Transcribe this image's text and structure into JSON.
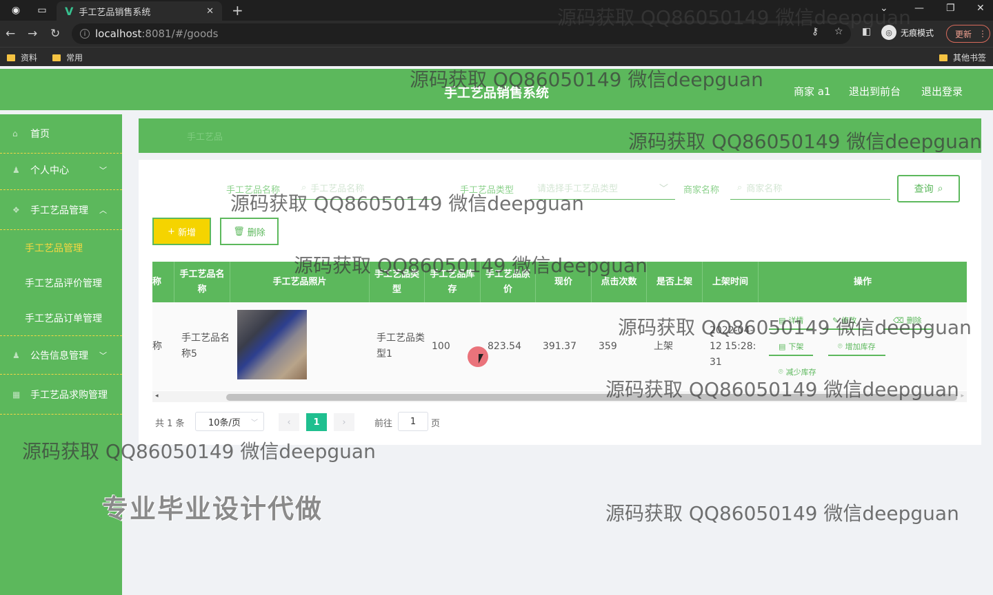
{
  "browser": {
    "tab_title": "手工艺品销售系统",
    "url_host": "localhost",
    "url_path": ":8081/#/goods",
    "incognito_label": "无痕模式",
    "update_label": "更新",
    "bookmarks": [
      "资料",
      "常用"
    ],
    "other_bookmarks": "其他书签"
  },
  "header": {
    "title": "手工艺品销售系统",
    "user": "商家 a1",
    "back_front": "退出到前台",
    "logout": "退出登录"
  },
  "sidebar": {
    "items": [
      {
        "label": "首页"
      },
      {
        "label": "个人中心"
      },
      {
        "label": "手工艺品管理"
      },
      {
        "label": "公告信息管理"
      },
      {
        "label": "手工艺品求购管理"
      }
    ],
    "sub_items": [
      "手工艺品管理",
      "手工艺品评价管理",
      "手工艺品订单管理"
    ]
  },
  "breadcrumb": "手工艺品",
  "filters": {
    "name_label": "手工艺品名称",
    "name_placeholder": "手工艺品名称",
    "type_label": "手工艺品类型",
    "type_placeholder": "请选择手工艺品类型",
    "shop_label": "商家名称",
    "shop_placeholder": "商家名称",
    "search_button": "查询"
  },
  "buttons": {
    "add": "新增",
    "delete": "删除"
  },
  "table": {
    "headers": [
      "称",
      "手工艺品名称",
      "手工艺品照片",
      "手工艺品类型",
      "手工艺品库存",
      "手工艺品原价",
      "现价",
      "点击次数",
      "是否上架",
      "上架时间",
      "操作"
    ],
    "row": {
      "col0": "称",
      "name": "手工艺品名称5",
      "type": "手工艺品类型1",
      "stock": "100",
      "original_price": "823.54",
      "price": "391.37",
      "clicks": "359",
      "on_shelf": "上架",
      "time": "2022-04-12 15:28:31"
    },
    "actions": [
      "详情",
      "修改",
      "删除",
      "下架",
      "增加库存",
      "减少库存"
    ]
  },
  "pagination": {
    "total": "共 1 条",
    "page_size": "10条/页",
    "current": "1",
    "goto_prefix": "前往",
    "goto_value": "1",
    "goto_suffix": "页"
  },
  "watermark": "源码获取 QQ86050149 微信deepguan",
  "promo": "专业毕业设计代做"
}
